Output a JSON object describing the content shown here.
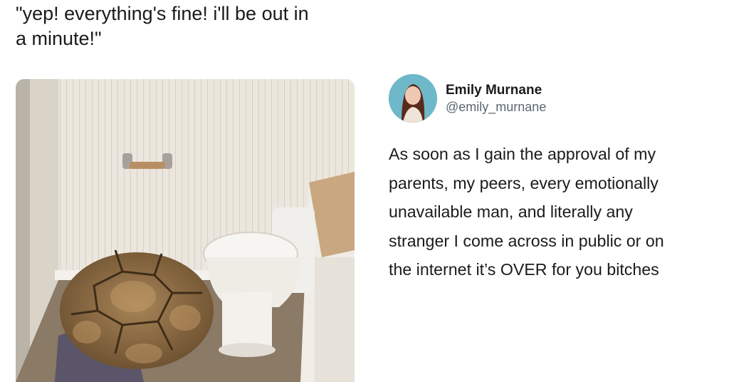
{
  "caption": {
    "line1": "\"yep! everything's fine! i'll be out in",
    "line2": "a minute!\""
  },
  "photo": {
    "subject": "tortoise-behind-toilet"
  },
  "tweet": {
    "display_name": "Emily Murnane",
    "handle": "@emily_murnane",
    "lines": [
      "As soon as I gain the approval of my",
      "parents, my peers, every emotionally",
      "unavailable man, and literally any",
      "stranger I come across in public or on",
      "the internet it’s OVER for you bitches"
    ]
  },
  "colors": {
    "background": "#ffffff",
    "text": "#1b1b1b",
    "handle": "#5b6670",
    "avatar_bg": "#6fb8c9"
  }
}
